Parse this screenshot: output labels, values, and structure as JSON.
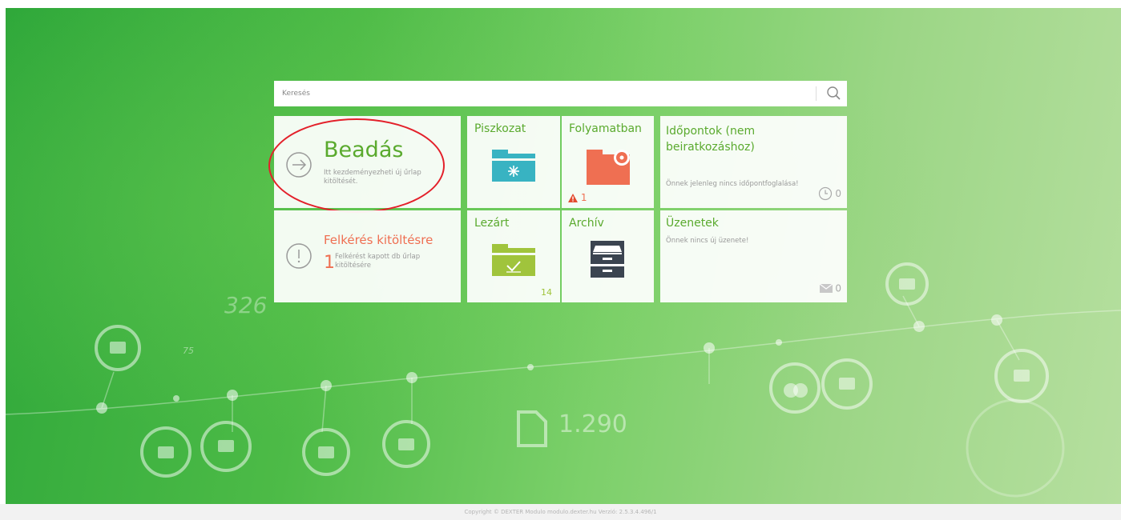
{
  "search": {
    "placeholder": "Keresés",
    "icon": "search-icon"
  },
  "tiles": {
    "beadas": {
      "title": "Beadás",
      "subtitle": "Itt kezdeményezheti új űrlap kitöltését."
    },
    "felkeres": {
      "title": "Felkérés kitöltésre",
      "count": "1",
      "subtitle": "Felkérést kapott db űrlap kitöltésére"
    },
    "piszkozat": {
      "title": "Piszkozat"
    },
    "folyamatban": {
      "title": "Folyamatban",
      "warning_count": "1"
    },
    "lezart": {
      "title": "Lezárt",
      "count": "14"
    },
    "archiv": {
      "title": "Archív"
    },
    "idopontok": {
      "title": "Időpontok (nem beiratkozáshoz)",
      "subtitle": "Önnek jelenleg nincs időpontfoglalása!",
      "count": "0"
    },
    "uzenetek": {
      "title": "Üzenetek",
      "subtitle": "Önnek nincs új üzenete!",
      "count": "0"
    }
  },
  "background_numbers": [
    "326",
    "75",
    "1.290"
  ],
  "footer": {
    "text": "Copyright © DEXTER Modulo modulo.dexter.hu Verzió: 2.5.3.4.496/1"
  },
  "colors": {
    "accent_green": "#5aaa2e",
    "alert_orange": "#ef6f52",
    "folder_teal": "#38b3c2",
    "folder_red": "#ef6f52",
    "folder_lime": "#a0c43c",
    "archive_dark": "#3b4450",
    "highlight_ellipse": "#e3202a"
  }
}
